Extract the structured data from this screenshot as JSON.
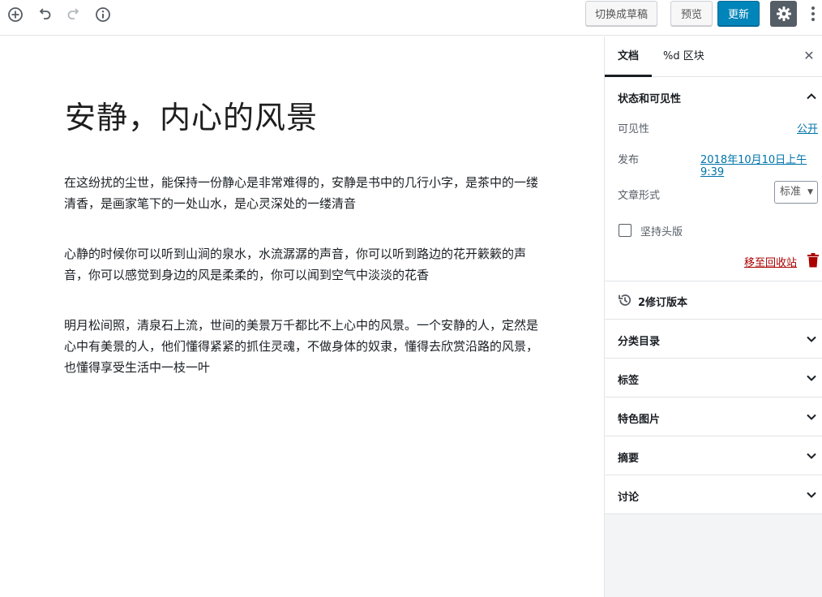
{
  "toolbar": {
    "add_icon": "plus-circle-icon",
    "undo_icon": "undo-icon",
    "redo_icon": "redo-icon",
    "info_icon": "info-icon",
    "draft_label": "切换成草稿",
    "preview_label": "预览",
    "update_label": "更新",
    "settings_icon": "gear-icon",
    "more_icon": "more-vertical-icon",
    "accent": "#0085ba"
  },
  "editor": {
    "title": "安静，内心的风景",
    "paragraphs": [
      "在这纷扰的尘世，能保持一份静心是非常难得的，安静是书中的几行小字，是茶中的一缕清香，是画家笔下的一处山水，是心灵深处的一缕清音",
      "心静的时候你可以听到山涧的泉水，水流潺潺的声音，你可以听到路边的花开簌簌的声音，你可以感觉到身边的风是柔柔的，你可以闻到空气中淡淡的花香",
      "明月松间照，清泉石上流，世间的美景万千都比不上心中的风景。一个安静的人，定然是心中有美景的人，他们懂得紧紧的抓住灵魂，不做身体的奴隶，懂得去欣赏沿路的风景，也懂得享受生活中一枝一叶"
    ]
  },
  "sidebar": {
    "tab_document": "文档",
    "tab_block": "%d 区块",
    "close_icon": "close-icon",
    "status": {
      "title": "状态和可见性",
      "visibility_label": "可见性",
      "visibility_value": "公开",
      "publish_label": "发布",
      "publish_value": "2018年10月10日上午9:39",
      "format_label": "文章形式",
      "format_value": "标准",
      "sticky_label": "坚持头版",
      "trash_label": "移至回收站"
    },
    "revisions_label": "2修订版本",
    "panels": [
      "分类目录",
      "标签",
      "特色图片",
      "摘要",
      "讨论"
    ]
  }
}
